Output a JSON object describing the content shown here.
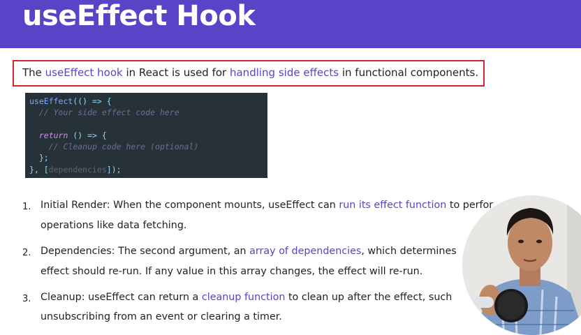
{
  "slide": {
    "title": "useEffect Hook",
    "intro": {
      "p1": "The ",
      "h1": "useEffect hook",
      "p2": " in React is used for ",
      "h2": "handling side effects",
      "p3": " in functional components."
    }
  },
  "code": {
    "fn": "useEffect",
    "open": "(() => {",
    "comment1": "// Your side effect code here",
    "kw_return": "return",
    "ret_arrow": " () => {",
    "comment2": "// Cleanup code here (optional)",
    "inner_close": "};",
    "close": "}, [",
    "deps": "dependencies",
    "end": "]);"
  },
  "list": [
    {
      "number": "1.",
      "l1_a": "Initial Render:  When the component mounts, useEffect can ",
      "l1_h": "run its effect function",
      "l1_b": " to perfor",
      "l2": "operations like data fetching."
    },
    {
      "number": "2.",
      "l1_a": "Dependencies: The second argument, an ",
      "l1_h": "array of dependencies",
      "l1_b": ", which determines",
      "l2": "effect should re-run. If any value in this array changes, the effect will re-run."
    },
    {
      "number": "3.",
      "l1_a": "Cleanup: useEffect can return a ",
      "l1_h": "cleanup function",
      "l1_b": " to clean up after the effect, such",
      "l2": "unsubscribing from an event or clearing a timer."
    }
  ],
  "colors": {
    "header": "#5a43c6",
    "highlight": "#5a43c6",
    "box_border": "#d4262c",
    "code_bg": "#263238"
  }
}
